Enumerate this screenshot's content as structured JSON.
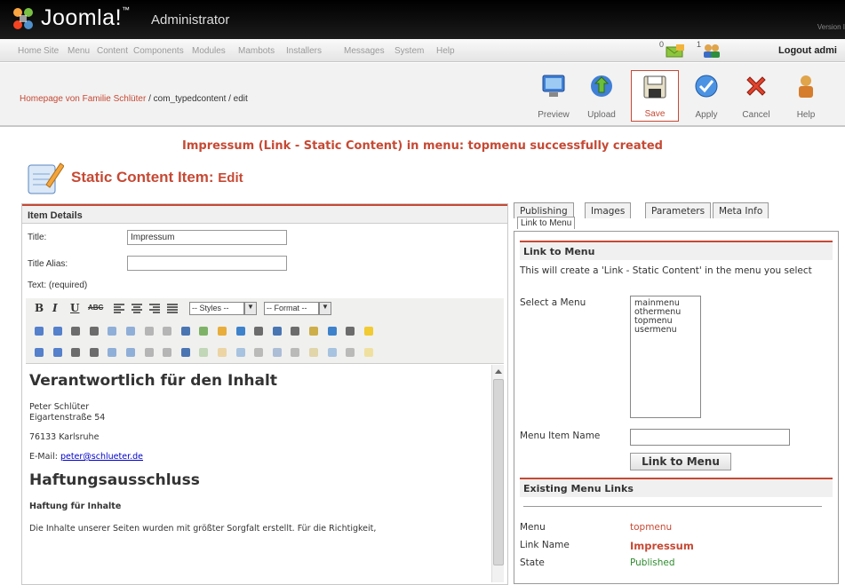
{
  "header": {
    "brand": "Joomla!",
    "trademark": "™",
    "subtitle": "Administrator",
    "version_fragment": "Version I"
  },
  "menubar": {
    "items": [
      "Home",
      "Site",
      "Menu",
      "Content",
      "Components",
      "Modules",
      "Mambots",
      "Installers",
      "Messages",
      "System",
      "Help"
    ],
    "mail_count": "0",
    "users_count": "1",
    "logout": "Logout admi"
  },
  "breadcrumb": {
    "site": "Homepage von Familie Schlüter",
    "rest": " / com_typedcontent / edit"
  },
  "toolbar": [
    {
      "label": "Preview",
      "icon": "preview-icon"
    },
    {
      "label": "Upload",
      "icon": "upload-icon"
    },
    {
      "label": "Save",
      "icon": "save-icon"
    },
    {
      "label": "Apply",
      "icon": "apply-icon"
    },
    {
      "label": "Cancel",
      "icon": "cancel-icon"
    },
    {
      "label": "Help",
      "icon": "help-icon"
    }
  ],
  "message": "Impressum (Link - Static Content) in menu: topmenu successfully created",
  "page": {
    "title": "Static Content Item:",
    "subtitle": "Edit"
  },
  "item_details": {
    "heading": "Item Details",
    "title_label": "Title:",
    "title_value": "Impressum",
    "alias_label": "Title Alias:",
    "alias_value": "",
    "text_label": "Text: (required)",
    "styles_dd": "-- Styles --",
    "format_dd": "-- Format --"
  },
  "editor_content": {
    "h1": "Verantwortlich für den Inhalt",
    "addr1": "Peter Schlüter",
    "addr2": "Eigartenstraße 54",
    "city": "76133 Karlsruhe",
    "email_label": "E-Mail: ",
    "email": "peter@schlueter.de",
    "h2": "Haftungsausschluss",
    "h3": "Haftung für Inhalte",
    "para": "Die Inhalte unserer Seiten wurden mit größter Sorgfalt erstellt. Für die Richtigkeit,"
  },
  "tabs": [
    "Publishing",
    "Images",
    "Parameters",
    "Meta Info"
  ],
  "subtab": "Link to Menu",
  "link_to_menu": {
    "heading": "Link to Menu",
    "desc": "This will create a 'Link - Static Content' in the menu you select",
    "select_label": "Select a Menu",
    "menus": [
      "mainmenu",
      "othermenu",
      "topmenu",
      "usermenu"
    ],
    "name_label": "Menu Item Name",
    "name_value": "",
    "button": "Link to Menu"
  },
  "existing": {
    "heading": "Existing Menu Links",
    "menu_label": "Menu",
    "menu_value": "topmenu",
    "link_label": "Link Name",
    "link_value": "Impressum",
    "state_label": "State",
    "state_value": "Published"
  },
  "colors": {
    "accent": "#c64934",
    "published": "#2e8b2e",
    "topbar": "#000000"
  }
}
